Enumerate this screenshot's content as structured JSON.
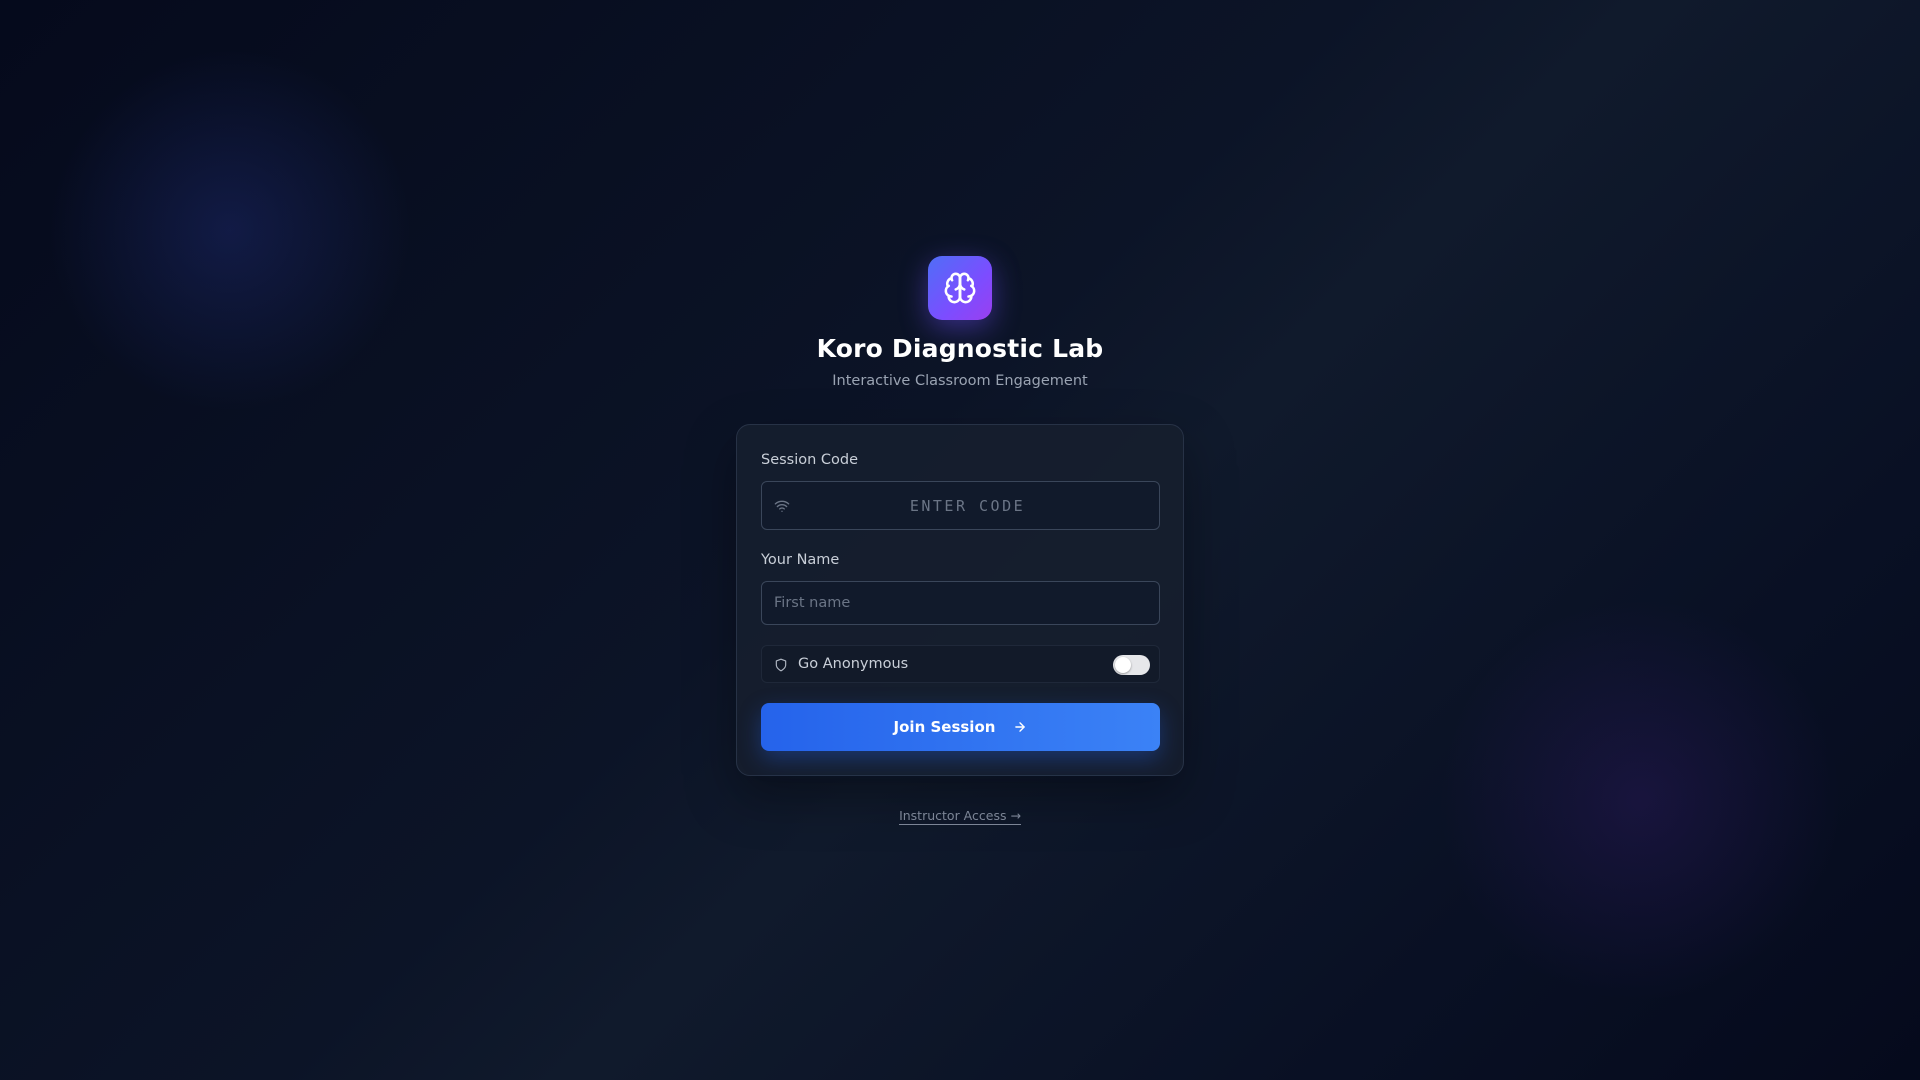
{
  "app": {
    "title": "Koro Diagnostic Lab",
    "subtitle": "Interactive Classroom Engagement",
    "logo_icon": "brain-icon"
  },
  "form": {
    "session_code": {
      "label": "Session Code",
      "placeholder": "ENTER CODE",
      "value": "",
      "icon": "wifi-icon"
    },
    "name": {
      "label": "Your Name",
      "placeholder": "First name",
      "value": ""
    },
    "anonymous": {
      "label": "Go Anonymous",
      "icon": "shield-icon",
      "enabled": false
    },
    "submit": {
      "label": "Join Session",
      "icon": "arrow-right-icon"
    }
  },
  "footer": {
    "instructor_link": "Instructor Access →"
  },
  "colors": {
    "accent": "#2563eb",
    "logo_gradient_start": "#4f6ef7",
    "logo_gradient_end": "#9a3ff0"
  }
}
